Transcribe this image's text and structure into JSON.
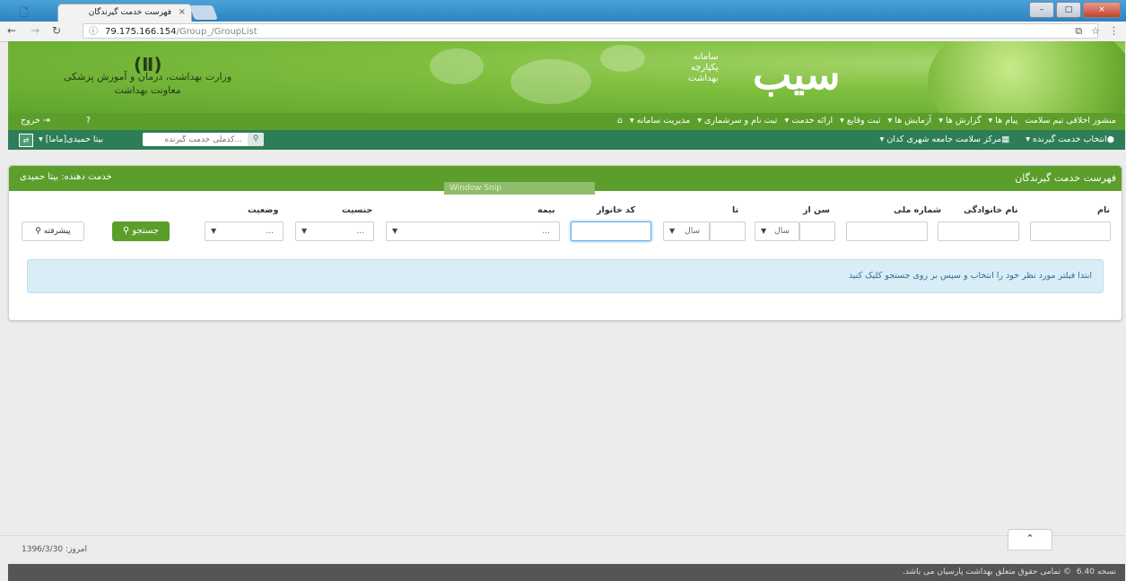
{
  "browser": {
    "tab_title": "فهرست خدمت گیرندگان",
    "tab_close": "×",
    "url_host": "79.175.166.154",
    "url_path": "/Group_/GroupList",
    "window_min": "–",
    "window_max": "□",
    "window_close": "×"
  },
  "header": {
    "logo_text": "سیب",
    "logo_sub_line1": "سامانه",
    "logo_sub_line2": "یکپارچه",
    "logo_sub_line3": "بهداشت",
    "ministry_line1": "وزارت بهداشت، درمان و آموزش پزشکی",
    "ministry_line2": "معاونت بهداشت"
  },
  "menu": {
    "items": [
      "مدیریت سامانه",
      "ثبت نام و سرشماری",
      "ارائه خدمت",
      "ثبت وقایع",
      "آزمایش ها",
      "گزارش ها",
      "پیام ها",
      "منشور اخلاقی تیم سلامت"
    ],
    "exit": "خروج"
  },
  "subbar": {
    "center": "مرکز سلامت جامعه شهری کدان",
    "select_client": "انتخاب خدمت گیرنده",
    "search_placeholder": "کدملی خدمت گیرنده...",
    "user": "بیتا حمیدی[ماما]"
  },
  "card": {
    "title": "فهرست خدمت گیرندگان",
    "provider": "خدمت دهنده: بیتا حمیدی",
    "snip": "Window Snip"
  },
  "filters": {
    "first_name": "نام",
    "last_name": "نام خانوادگی",
    "national_id": "شماره ملی",
    "age_from": "سن از",
    "age_to": "تا",
    "family_code": "کد خانوار",
    "insurance": "بیمه",
    "gender": "جنسیت",
    "status": "وضعیت",
    "year_unit": "سال",
    "placeholder_dots": "...",
    "search_btn": "جستجو",
    "advanced_btn": "پیشرفته"
  },
  "alert": {
    "text": "ابتدا فیلتر مورد نظر خود را انتخاب و سپس بر روی جستجو کلیک کنید"
  },
  "footer": {
    "today_label": "امروز:",
    "today_date": "1396/3/30",
    "version": "نسخه 6.40",
    "copyright": "© تمامی حقوق متعلق بهداشت پارسیان می باشد."
  }
}
